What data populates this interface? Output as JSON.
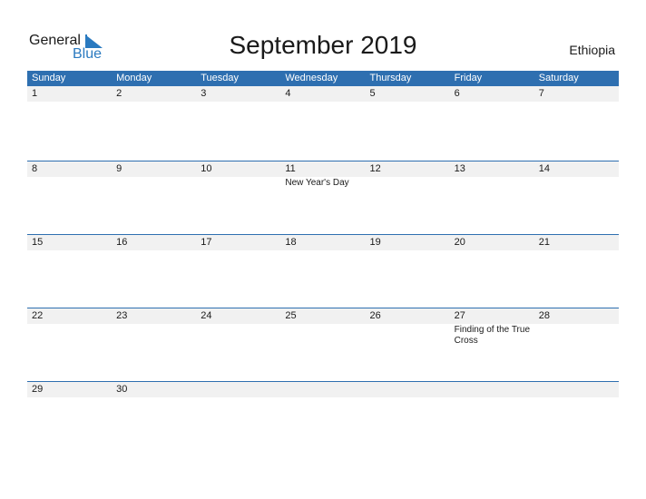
{
  "logo": {
    "general": "General",
    "blue": "Blue"
  },
  "title": "September 2019",
  "country": "Ethiopia",
  "colors": {
    "accent": "#2e6fb0",
    "strip": "#f1f1f1",
    "logo_blue": "#2a7ac0"
  },
  "weekdays": [
    "Sunday",
    "Monday",
    "Tuesday",
    "Wednesday",
    "Thursday",
    "Friday",
    "Saturday"
  ],
  "weeks": [
    {
      "days": [
        "1",
        "2",
        "3",
        "4",
        "5",
        "6",
        "7"
      ],
      "events": [
        "",
        "",
        "",
        "",
        "",
        "",
        ""
      ]
    },
    {
      "days": [
        "8",
        "9",
        "10",
        "11",
        "12",
        "13",
        "14"
      ],
      "events": [
        "",
        "",
        "",
        "New Year's Day",
        "",
        "",
        ""
      ]
    },
    {
      "days": [
        "15",
        "16",
        "17",
        "18",
        "19",
        "20",
        "21"
      ],
      "events": [
        "",
        "",
        "",
        "",
        "",
        "",
        ""
      ]
    },
    {
      "days": [
        "22",
        "23",
        "24",
        "25",
        "26",
        "27",
        "28"
      ],
      "events": [
        "",
        "",
        "",
        "",
        "",
        "Finding of the True Cross",
        ""
      ]
    },
    {
      "days": [
        "29",
        "30",
        "",
        "",
        "",
        "",
        ""
      ],
      "events": [
        "",
        "",
        "",
        "",
        "",
        "",
        ""
      ]
    }
  ]
}
